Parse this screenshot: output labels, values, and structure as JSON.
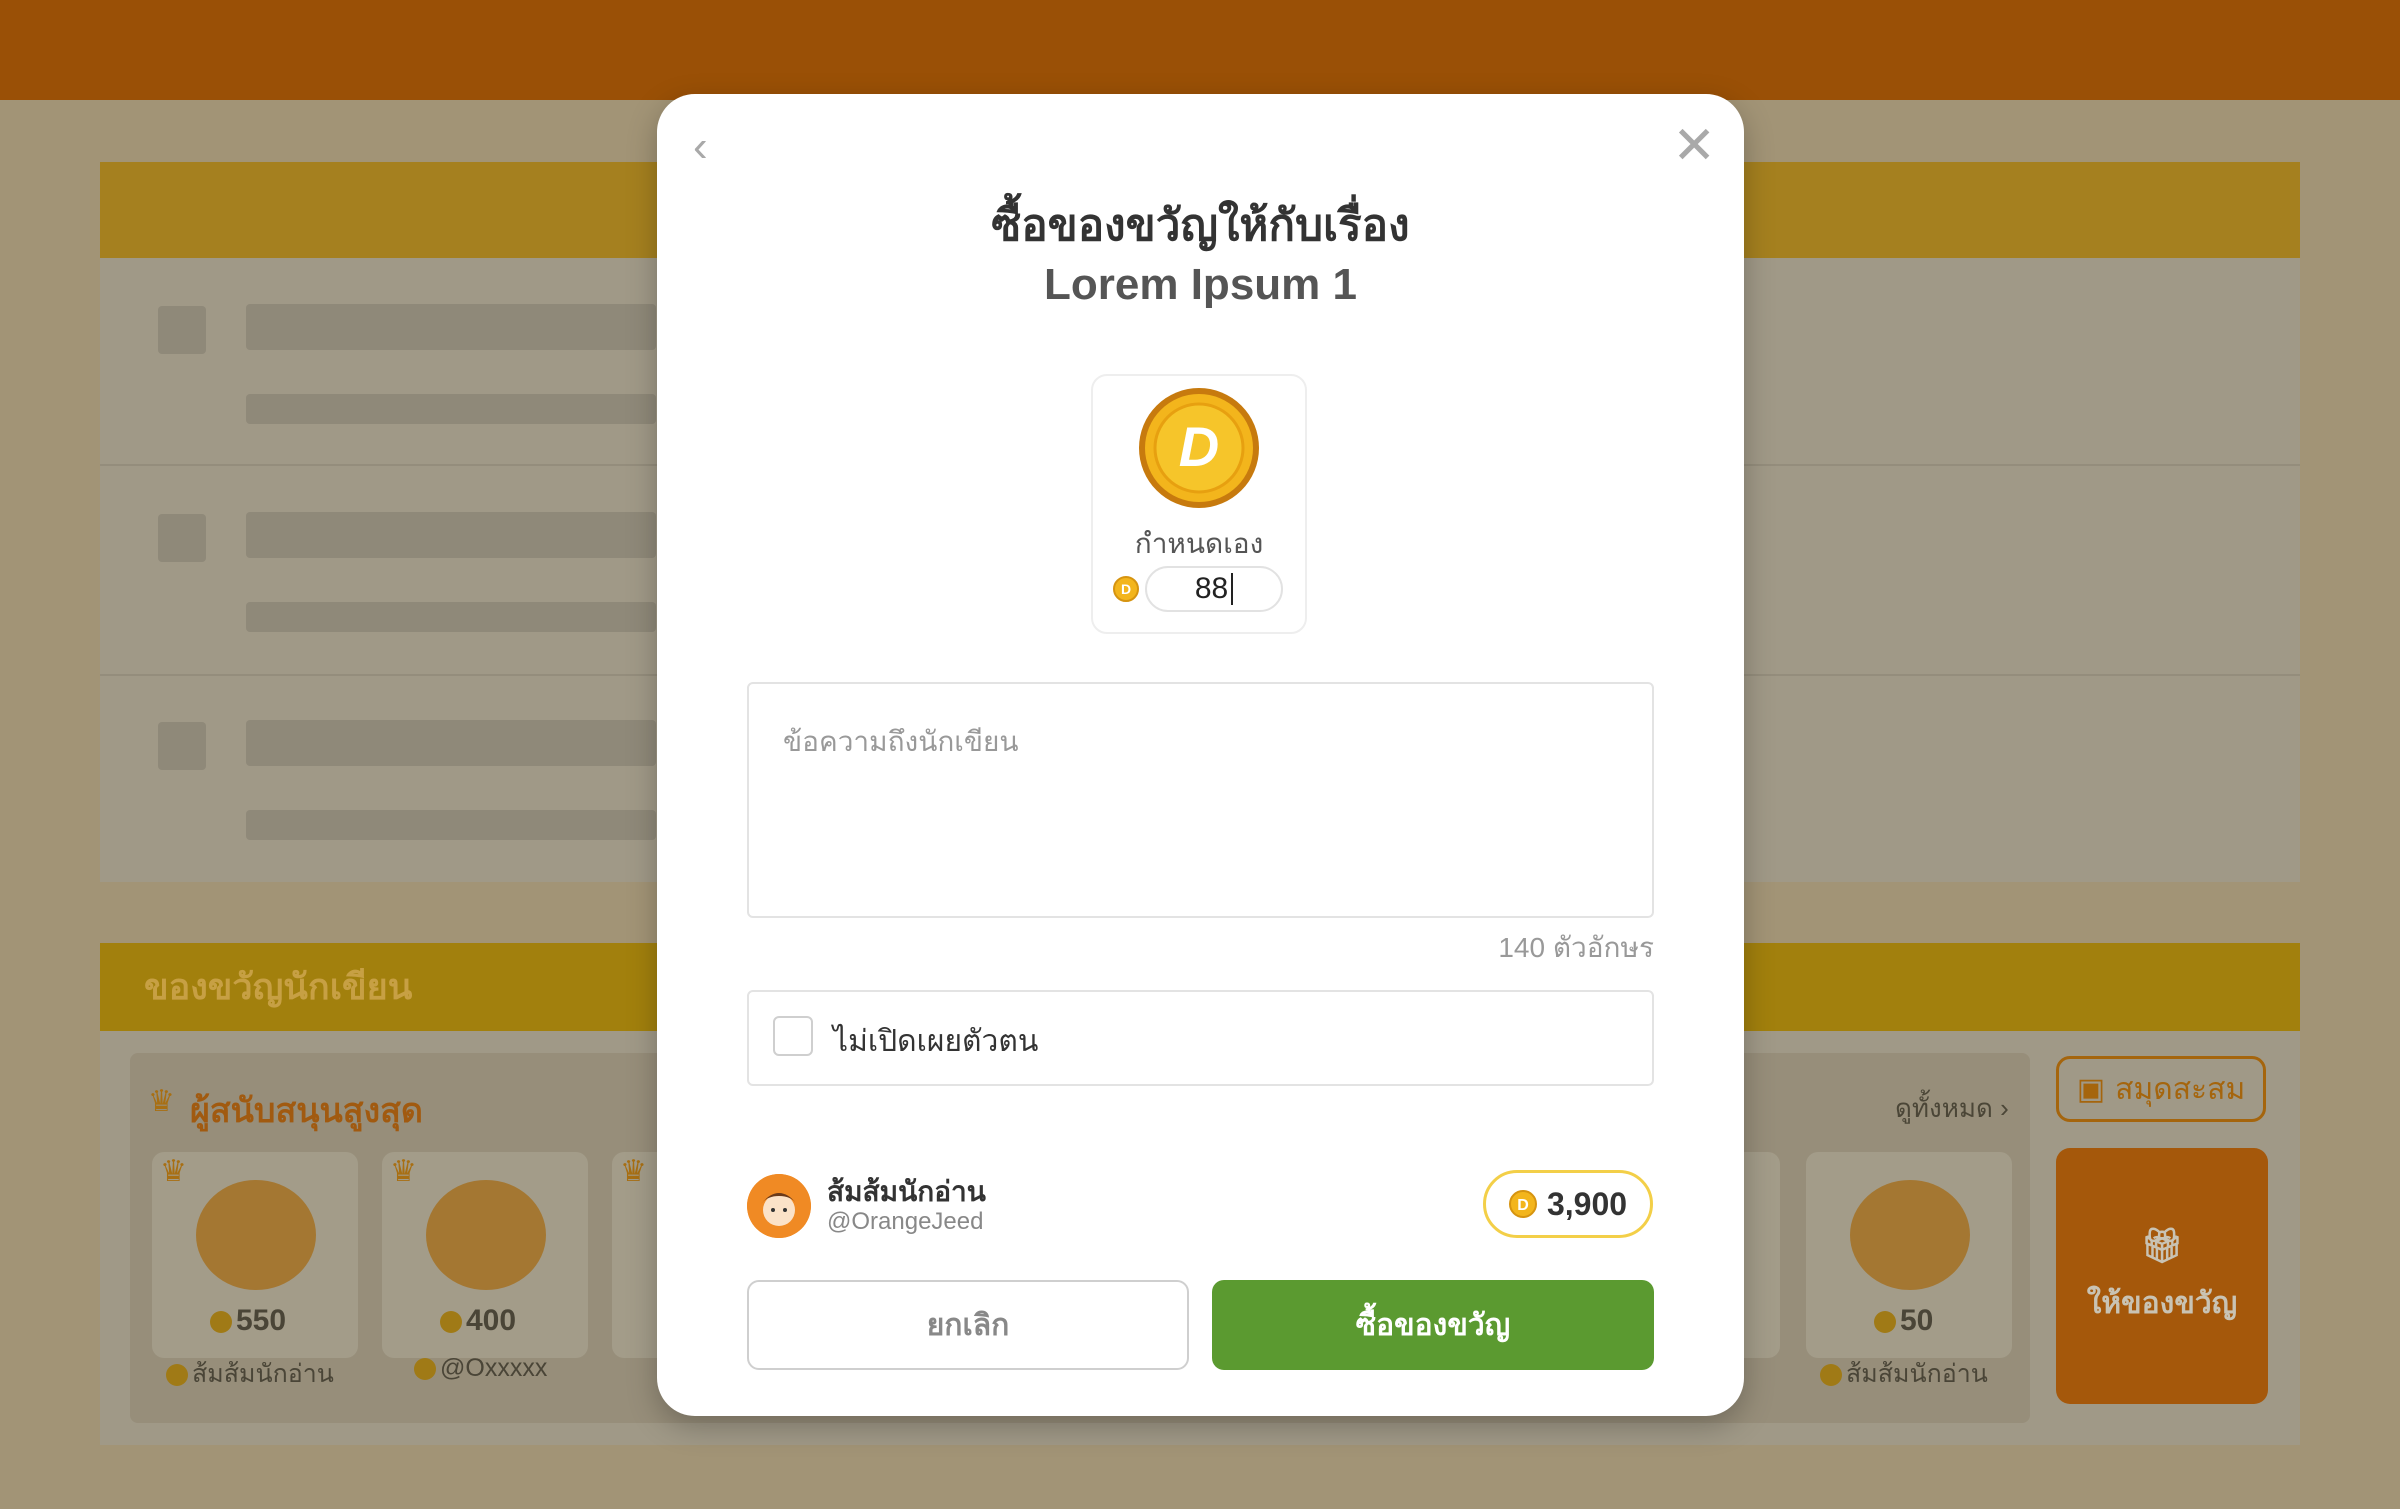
{
  "background": {
    "gift_section_title": "ของขวัญนักเขียน",
    "supporters_title": "ผู้สนับสนุนสูงสุด",
    "see_all": "ดูทั้งหมด",
    "cards": [
      {
        "price": "550",
        "user": "ส้มส้มนักอ่าน"
      },
      {
        "price": "400",
        "user": "@Oxxxxx"
      },
      {
        "price": "50",
        "user": "ส้มส้มนักอ่าน"
      }
    ],
    "collection_button": "สมุดสะสม",
    "give_gift_button": "ให้ของขวัญ"
  },
  "modal": {
    "title": "ซื้อของขวัญให้กับเรื่อง",
    "story_name": "Lorem Ipsum 1",
    "gift": {
      "label": "กำหนดเอง",
      "amount": "88"
    },
    "message": {
      "placeholder": "ข้อความถึงนักเขียน",
      "char_limit": "140 ตัวอักษร"
    },
    "anonymous_label": "ไม่เปิดเผยตัวตน",
    "user": {
      "name": "ส้มส้มนักอ่าน",
      "handle": "@OrangeJeed",
      "balance": "3,900"
    },
    "cancel_label": "ยกเลิก",
    "buy_label": "ซื้อของขวัญ"
  },
  "colors": {
    "primary_orange": "#e98300",
    "buy_green": "#5b9a30",
    "coin_gold": "#f3b51c"
  }
}
